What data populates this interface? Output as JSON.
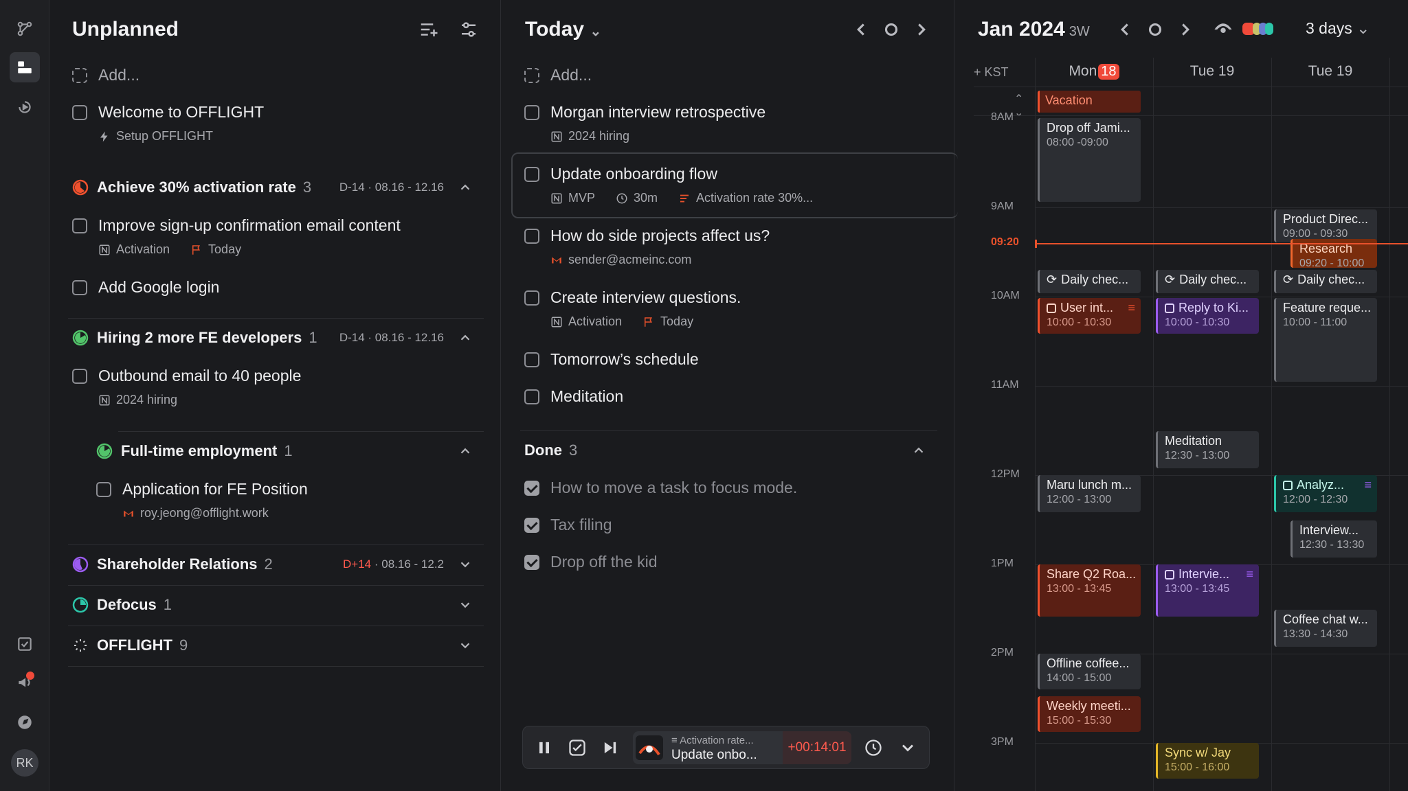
{
  "unplanned": {
    "title": "Unplanned",
    "add_placeholder": "Add...",
    "tasks": [
      {
        "title": "Welcome to OFFLIGHT",
        "meta": "Setup OFFLIGHT"
      }
    ],
    "groups": [
      {
        "name": "Achieve 30% activation rate",
        "count": "3",
        "dday": "D-14",
        "range": "· 08.16 - 12.16",
        "color": "#f0512e",
        "tasks": [
          {
            "title": "Improve sign-up confirmation email content",
            "project": "Activation",
            "flag": "Today"
          },
          {
            "title": "Add Google login"
          }
        ]
      },
      {
        "name": "Hiring 2 more FE developers",
        "count": "1",
        "dday": "D-14",
        "range": "· 08.16 - 12.16",
        "color": "#52c46a",
        "tasks": [
          {
            "title": "Outbound email to 40 people",
            "project": "2024 hiring"
          }
        ],
        "subgroup": {
          "name": "Full-time employment",
          "count": "1",
          "tasks": [
            {
              "title": "Application for FE Position",
              "email": "roy.jeong@offlight.work"
            }
          ]
        }
      },
      {
        "name": "Shareholder Relations",
        "count": "2",
        "dday": "D+14",
        "range": "· 08.16 - 12.2",
        "color": "#9b5cf0"
      },
      {
        "name": "Defocus",
        "count": "1",
        "color": "#2cc6a9"
      },
      {
        "name": "OFFLIGHT",
        "count": "9"
      }
    ]
  },
  "today": {
    "title": "Today",
    "add_placeholder": "Add...",
    "tasks": [
      {
        "title": "Morgan interview retrospective",
        "meta": "2024 hiring"
      },
      {
        "title": "Update onboarding flow",
        "project": "MVP",
        "duration": "30m",
        "goal": "Activation rate 30%..."
      },
      {
        "title": "How do side projects affect us?",
        "email": "sender@acmeinc.com"
      },
      {
        "title": "Create interview questions.",
        "project": "Activation",
        "flag": "Today"
      },
      {
        "title": "Tomorrow’s schedule"
      },
      {
        "title": "Meditation"
      }
    ],
    "done": {
      "label": "Done",
      "count": "3",
      "tasks": [
        "How to move a task to focus mode.",
        "Tax filing",
        "Drop off the kid"
      ]
    },
    "player": {
      "goal": "Activation rate...",
      "task": "Update onbo...",
      "timer": "+00:14:01"
    }
  },
  "calendar": {
    "month": "Jan 2024",
    "week": "3W",
    "view": "3 days",
    "timezone": "KST",
    "days": [
      {
        "label": "Mon",
        "num": "18"
      },
      {
        "label": "Tue 19"
      },
      {
        "label": "Tue 19"
      }
    ],
    "allday": "Vacation",
    "hours": [
      "8AM",
      "9AM",
      "10AM",
      "11AM",
      "12PM",
      "1PM",
      "2PM",
      "3PM"
    ],
    "now": "09:20",
    "events": [
      {
        "title": "Drop off Jami...",
        "time": "08:00 -09:00",
        "color": "grey"
      },
      {
        "title": "Product Direc...",
        "time": "09:00 - 09:30",
        "color": "grey"
      },
      {
        "title": "Research",
        "time": "09:20 - 10:00",
        "color": "orange"
      },
      {
        "title": "Daily chec...",
        "color": "grey"
      },
      {
        "title": "Daily chec...",
        "color": "grey"
      },
      {
        "title": "Daily chec...",
        "color": "grey"
      },
      {
        "title": "User int...",
        "time": "10:00 - 10:30",
        "color": "red"
      },
      {
        "title": "Reply to Ki...",
        "time": "10:00 - 10:30",
        "color": "purple"
      },
      {
        "title": "Feature reque...",
        "time": "10:00 - 11:00",
        "color": "grey"
      },
      {
        "title": "Meditation",
        "time": "12:30 - 13:00",
        "color": "grey"
      },
      {
        "title": "Maru lunch m...",
        "time": "12:00 - 13:00",
        "color": "grey"
      },
      {
        "title": "Analyz...",
        "time": "12:00 - 12:30",
        "color": "teal"
      },
      {
        "title": "Interview...",
        "time": "12:30 - 13:30",
        "color": "grey"
      },
      {
        "title": "Share Q2 Roa...",
        "time": "13:00 - 13:45",
        "color": "red"
      },
      {
        "title": "Intervie...",
        "time": "13:00 - 13:45",
        "color": "purple"
      },
      {
        "title": "Coffee chat w...",
        "time": "13:30 - 14:30",
        "color": "grey"
      },
      {
        "title": "Offline coffee...",
        "time": "14:00 - 15:00",
        "color": "grey"
      },
      {
        "title": "Weekly meeti...",
        "time": "15:00 - 15:30",
        "color": "red"
      },
      {
        "title": "Sync w/ Jay",
        "time": "15:00 - 16:00",
        "color": "yellow"
      }
    ]
  },
  "rail": {
    "avatar": "RK"
  },
  "colors": {
    "accent_red": "#f04a3a",
    "orange": "#f0512e",
    "purple": "#9b5cf0",
    "green": "#52c46a",
    "teal": "#2cc6a9"
  }
}
